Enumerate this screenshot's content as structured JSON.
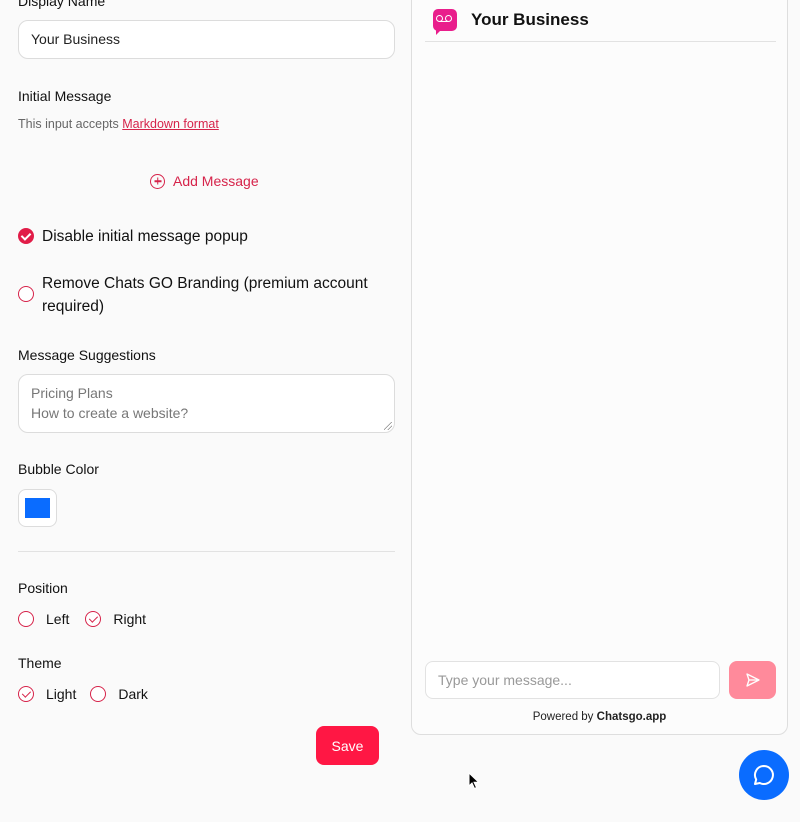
{
  "form": {
    "display_name_label": "Display Name",
    "display_name_value": "Your Business",
    "initial_message_label": "Initial Message",
    "markdown_hint_prefix": "This input accepts",
    "markdown_link": "Markdown format",
    "add_message_label": "Add Message",
    "disable_popup_label": "Disable initial message popup",
    "disable_popup_checked": true,
    "remove_branding_label": "Remove Chats GO Branding (premium account required)",
    "remove_branding_checked": false,
    "suggestions_label": "Message Suggestions",
    "suggestions": [
      "Pricing Plans",
      "How to create a website?"
    ],
    "bubble_color_label": "Bubble Color",
    "bubble_color": "#0a6cff",
    "position_label": "Position",
    "position_options": [
      {
        "label": "Left",
        "selected": false
      },
      {
        "label": "Right",
        "selected": true
      }
    ],
    "theme_label": "Theme",
    "theme_options": [
      {
        "label": "Light",
        "selected": true
      },
      {
        "label": "Dark",
        "selected": false
      }
    ],
    "save_label": "Save"
  },
  "preview": {
    "business_name": "Your Business",
    "input_placeholder": "Type your message...",
    "powered_prefix": "Powered by",
    "powered_brand": "Chatsgo.app"
  },
  "colors": {
    "accent": "#e11d48",
    "save_button": "#ff1744",
    "send_button": "#ff8a9b",
    "logo": "#e91e8c",
    "chat_bubble": "#0a6cff"
  },
  "icons": {
    "add": "plus-circle-icon",
    "logo": "voicemail-logo-icon",
    "send": "send-icon",
    "chat": "chat-bubble-icon",
    "cursor": "mouse-pointer-icon"
  }
}
